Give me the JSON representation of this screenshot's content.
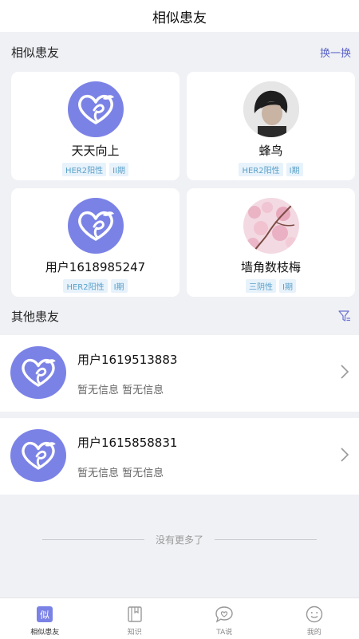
{
  "header": {
    "title": "相似患友"
  },
  "similar": {
    "title": "相似患友",
    "refresh_label": "换一换",
    "cards": [
      {
        "name": "天天向上",
        "tags": [
          "HER2阳性",
          "II期"
        ],
        "avatar": "app-logo"
      },
      {
        "name": "蜂鸟",
        "tags": [
          "HER2阳性",
          "I期"
        ],
        "avatar": "user-photo"
      },
      {
        "name": "用户1618985247",
        "tags": [
          "HER2阳性",
          "I期"
        ],
        "avatar": "app-logo"
      },
      {
        "name": "墙角数枝梅",
        "tags": [
          "三阴性",
          "I期"
        ],
        "avatar": "blossom-photo"
      }
    ]
  },
  "others": {
    "title": "其他患友",
    "items": [
      {
        "name": "用户1619513883",
        "info": "暂无信息 暂无信息"
      },
      {
        "name": "用户1615858831",
        "info": "暂无信息 暂无信息"
      }
    ]
  },
  "no_more": "没有更多了",
  "tabs": [
    {
      "label": "相似患友",
      "icon": "similar-icon",
      "active": true
    },
    {
      "label": "知识",
      "icon": "book-icon",
      "active": false
    },
    {
      "label": "TA说",
      "icon": "chat-heart-icon",
      "active": false
    },
    {
      "label": "我的",
      "icon": "smile-icon",
      "active": false
    }
  ],
  "colors": {
    "accent": "#7b82e6",
    "link": "#5a64c8",
    "tag_bg": "#e7f2fb",
    "tag_text": "#5aa0c8"
  }
}
